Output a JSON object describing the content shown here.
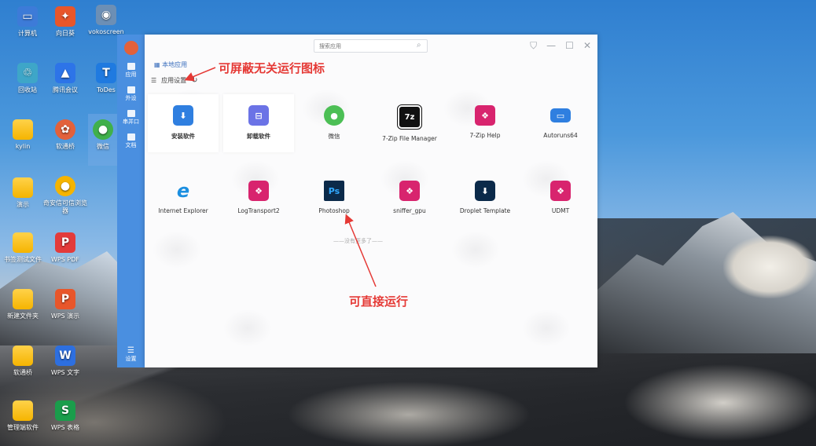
{
  "desktop": {
    "icons": [
      {
        "label": "计算机",
        "color": "#3d7bd8",
        "glyph": "▭"
      },
      {
        "label": "向日葵",
        "color": "#e8562a",
        "glyph": "✦"
      },
      {
        "label": "vokoscreen",
        "color": "#6c8fb5",
        "glyph": "◉"
      },
      {
        "label": "回收站",
        "color": "#3ea6c8",
        "glyph": "♲"
      },
      {
        "label": "腾讯会议",
        "color": "#2d74e8",
        "glyph": "▲"
      },
      {
        "label": "ToDes",
        "color": "#1f7ae0",
        "glyph": "T"
      },
      {
        "label": "kylin",
        "color": "",
        "glyph": ""
      },
      {
        "label": "软通桥",
        "color": "#e2613b",
        "glyph": "✿"
      },
      {
        "label": "微信",
        "color": "#40b04b",
        "glyph": "●"
      },
      {
        "label": "演示",
        "color": "",
        "glyph": ""
      },
      {
        "label": "奇安信可信浏览器",
        "color": "#f5b400",
        "glyph": "●"
      },
      {
        "label": "书签测试文件",
        "color": "",
        "glyph": ""
      },
      {
        "label": "WPS PDF",
        "color": "#e33b3b",
        "glyph": "P"
      },
      {
        "label": "新建文件夹",
        "color": "",
        "glyph": ""
      },
      {
        "label": "WPS 演示",
        "color": "#e8562a",
        "glyph": "P"
      },
      {
        "label": "软通桥",
        "color": "",
        "glyph": ""
      },
      {
        "label": "WPS 文字",
        "color": "#2d6fe0",
        "glyph": "W"
      },
      {
        "label": "管理端软件",
        "color": "",
        "glyph": ""
      },
      {
        "label": "WPS 表格",
        "color": "#1a9d4b",
        "glyph": "S"
      }
    ]
  },
  "dock": {
    "items": [
      {
        "label": "应用",
        "icon": "apps-icon"
      },
      {
        "label": "外设",
        "icon": "usb-icon"
      },
      {
        "label": "串并口",
        "icon": "port-icon"
      },
      {
        "label": "文档",
        "icon": "folder-icon"
      }
    ],
    "bottom_label": "设置"
  },
  "window": {
    "search_placeholder": "搜索应用",
    "search_icon": "⌕",
    "controls": [
      "⛉",
      "—",
      "☐",
      "✕"
    ],
    "tab_label": "本地应用",
    "settings_label": "应用设置",
    "refresh_icon": "↻",
    "no_more_text": "——没有更多了——"
  },
  "apps": [
    {
      "name": "安装软件",
      "color": "#2f7fe0",
      "glyph": "⬇",
      "card": true,
      "bold": true
    },
    {
      "name": "卸载软件",
      "color": "#6b73e6",
      "glyph": "⊟",
      "card": true,
      "bold": true
    },
    {
      "name": "微信",
      "color": "#4cbf55",
      "glyph": "●",
      "card": false,
      "bold": false
    },
    {
      "name": "7-Zip File Manager",
      "color": "#111111",
      "glyph": "7z",
      "card": false,
      "bold": false
    },
    {
      "name": "7-Zip Help",
      "color": "#d8246e",
      "glyph": "❖",
      "card": false,
      "bold": false
    },
    {
      "name": "Autoruns64",
      "color": "#2f7fe0",
      "glyph": "▭",
      "card": false,
      "bold": false
    },
    {
      "name": "Internet Explorer",
      "color": "#1c8fe0",
      "glyph": "e",
      "card": false,
      "bold": false
    },
    {
      "name": "LogTransport2",
      "color": "#d8246e",
      "glyph": "❖",
      "card": false,
      "bold": false
    },
    {
      "name": "Photoshop",
      "color": "#0b2a4a",
      "glyph": "Ps",
      "card": false,
      "bold": false
    },
    {
      "name": "sniffer_gpu",
      "color": "#d8246e",
      "glyph": "❖",
      "card": false,
      "bold": false
    },
    {
      "name": "Droplet Template",
      "color": "#0b2a4a",
      "glyph": "⬇",
      "card": false,
      "bold": false
    },
    {
      "name": "UDMT",
      "color": "#d8246e",
      "glyph": "❖",
      "card": false,
      "bold": false
    }
  ],
  "annotations": {
    "top": "可屏蔽无关运行图标",
    "bottom": "可直接运行"
  }
}
